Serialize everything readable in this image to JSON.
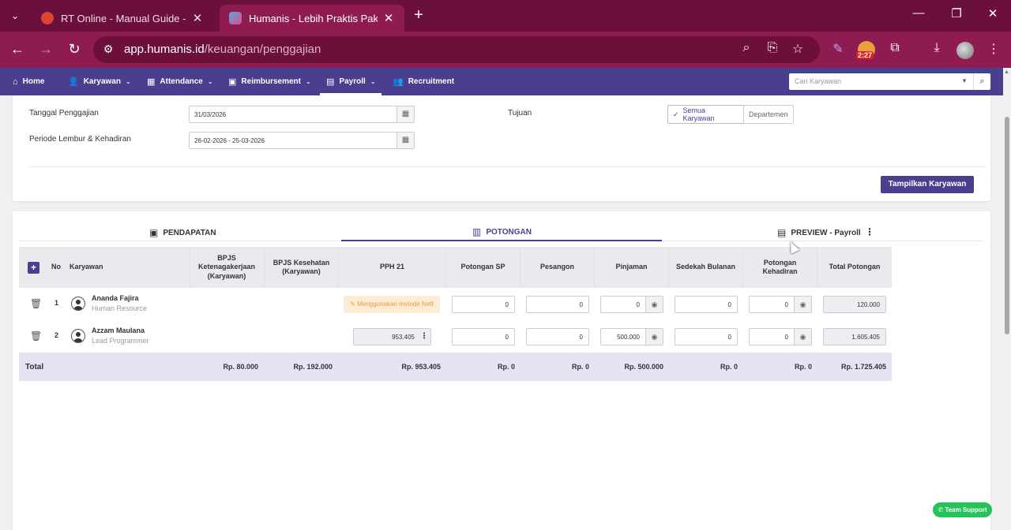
{
  "browser": {
    "tabs": [
      {
        "title": "RT Online - Manual Guide - Xm",
        "active": false,
        "favicon_color": "#e0452f"
      },
      {
        "title": "Humanis - Lebih Praktis Pakai H",
        "active": true,
        "favicon_color": "#5aa8e0"
      }
    ],
    "url_host": "app.humanis.id",
    "url_path": "/keuangan/penggajian",
    "extension_badge": "2:27"
  },
  "nav": {
    "items": [
      {
        "label": "Home",
        "icon": "home-icon"
      },
      {
        "label": "Karyawan",
        "icon": "user-edit-icon"
      },
      {
        "label": "Attendance",
        "icon": "calendar-icon"
      },
      {
        "label": "Reimbursement",
        "icon": "money-icon"
      },
      {
        "label": "Payroll",
        "icon": "wallet-icon"
      },
      {
        "label": "Recruitment",
        "icon": "users-icon"
      }
    ],
    "active": "Payroll",
    "search_placeholder": "Cari Karyawan"
  },
  "form": {
    "tanggal_label": "Tanggal Penggajian",
    "tanggal_value": "31/03/2026",
    "periode_label": "Periode Lembur & Kehadiran",
    "periode_value": "26-02-2026 - 25-03-2026",
    "tujuan_label": "Tujuan",
    "tujuan_options": [
      "Semua Karyawan",
      "Departemen"
    ],
    "tujuan_selected": "Semua Karyawan",
    "show_button": "Tampilkan Karyawan"
  },
  "tabs": {
    "pendapatan": "PENDAPATAN",
    "potongan": "POTONGAN",
    "preview": "PREVIEW - Payroll",
    "active": "POTONGAN"
  },
  "table": {
    "headers": {
      "no": "No",
      "karyawan": "Karyawan",
      "bpjs_tk": "BPJS Ketenagakerjaan (Karyawan)",
      "bpjs_kes": "BPJS Kesehatan (Karyawan)",
      "pph21": "PPH 21",
      "sp": "Potongan SP",
      "pesangon": "Pesangon",
      "pinjaman": "Pinjaman",
      "sedekah": "Sedekah Bulanan",
      "kehadiran": "Potongan Kehadiran",
      "total": "Total Potongan"
    },
    "rows": [
      {
        "no": "1",
        "name": "Ananda Fajira",
        "role": "Human Resource",
        "pph21_note": "Menggunakan metode Nett",
        "sp": "0",
        "pesangon": "0",
        "pinjaman": "0",
        "sedekah": "0",
        "kehadiran": "0",
        "total": "120.000"
      },
      {
        "no": "2",
        "name": "Azzam Maulana",
        "role": "Lead Programmer",
        "pph21": "953.405",
        "sp": "0",
        "pesangon": "0",
        "pinjaman": "500.000",
        "sedekah": "0",
        "kehadiran": "0",
        "total": "1.605.405"
      }
    ],
    "totals": {
      "label": "Total",
      "bpjs_tk": "Rp. 80.000",
      "bpjs_kes": "Rp. 192.000",
      "pph21": "Rp. 953.405",
      "sp": "Rp. 0",
      "pesangon": "Rp. 0",
      "pinjaman": "Rp. 500.000",
      "sedekah": "Rp. 0",
      "kehadiran": "Rp. 0",
      "total": "Rp. 1.725.405"
    }
  },
  "support_label": "Team Support",
  "colors": {
    "chrome_titlebar": "#6b0f3c",
    "chrome_toolbar": "#8e1c51",
    "brand": "#4a3e8f",
    "total_row": "#e6e3f4",
    "nett_badge_bg": "#fdebd3",
    "support": "#25c45a"
  }
}
